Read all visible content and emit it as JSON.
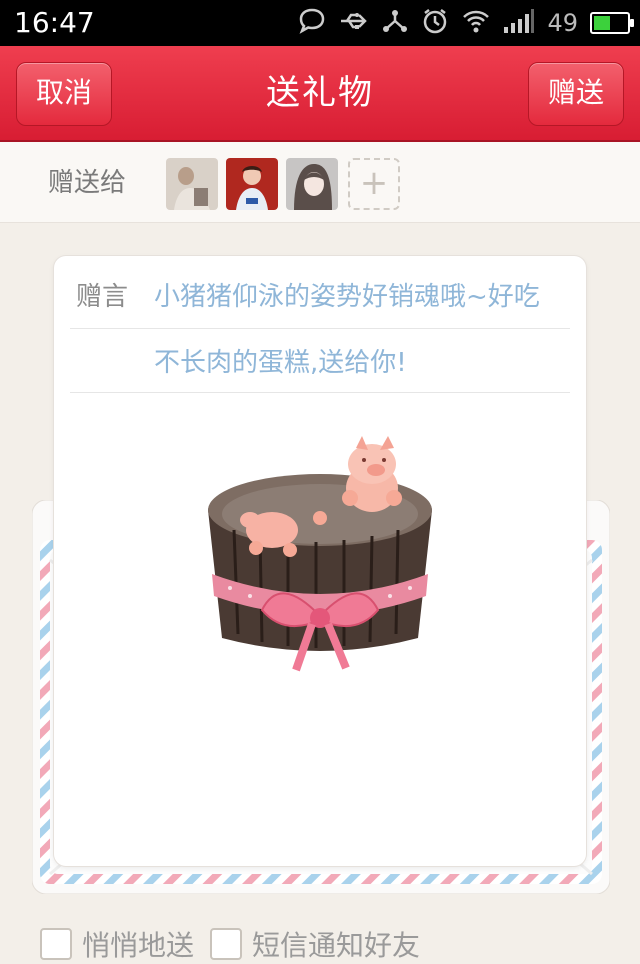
{
  "status_bar": {
    "time": "16:47",
    "battery_level": "49",
    "icons": [
      "chat-icon",
      "usb-icon",
      "share-icon",
      "alarm-icon",
      "wifi-icon",
      "signal-icon",
      "battery-icon"
    ]
  },
  "header": {
    "title": "送礼物",
    "cancel_label": "取消",
    "send_label": "赠送",
    "color": "#e02a3d"
  },
  "recipients": {
    "label": "赠送给",
    "avatars": [
      "avatar-1",
      "avatar-2",
      "avatar-3"
    ],
    "add_symbol": "+"
  },
  "message": {
    "label": "赠言",
    "line1": "小猪猪仰泳的姿势好销魂哦~好吃",
    "line2": "不长肉的蛋糕,送给你!"
  },
  "gift": {
    "icon": "pig-cake-image"
  },
  "options": {
    "secret_label": "悄悄地送",
    "sms_label": "短信通知好友"
  }
}
